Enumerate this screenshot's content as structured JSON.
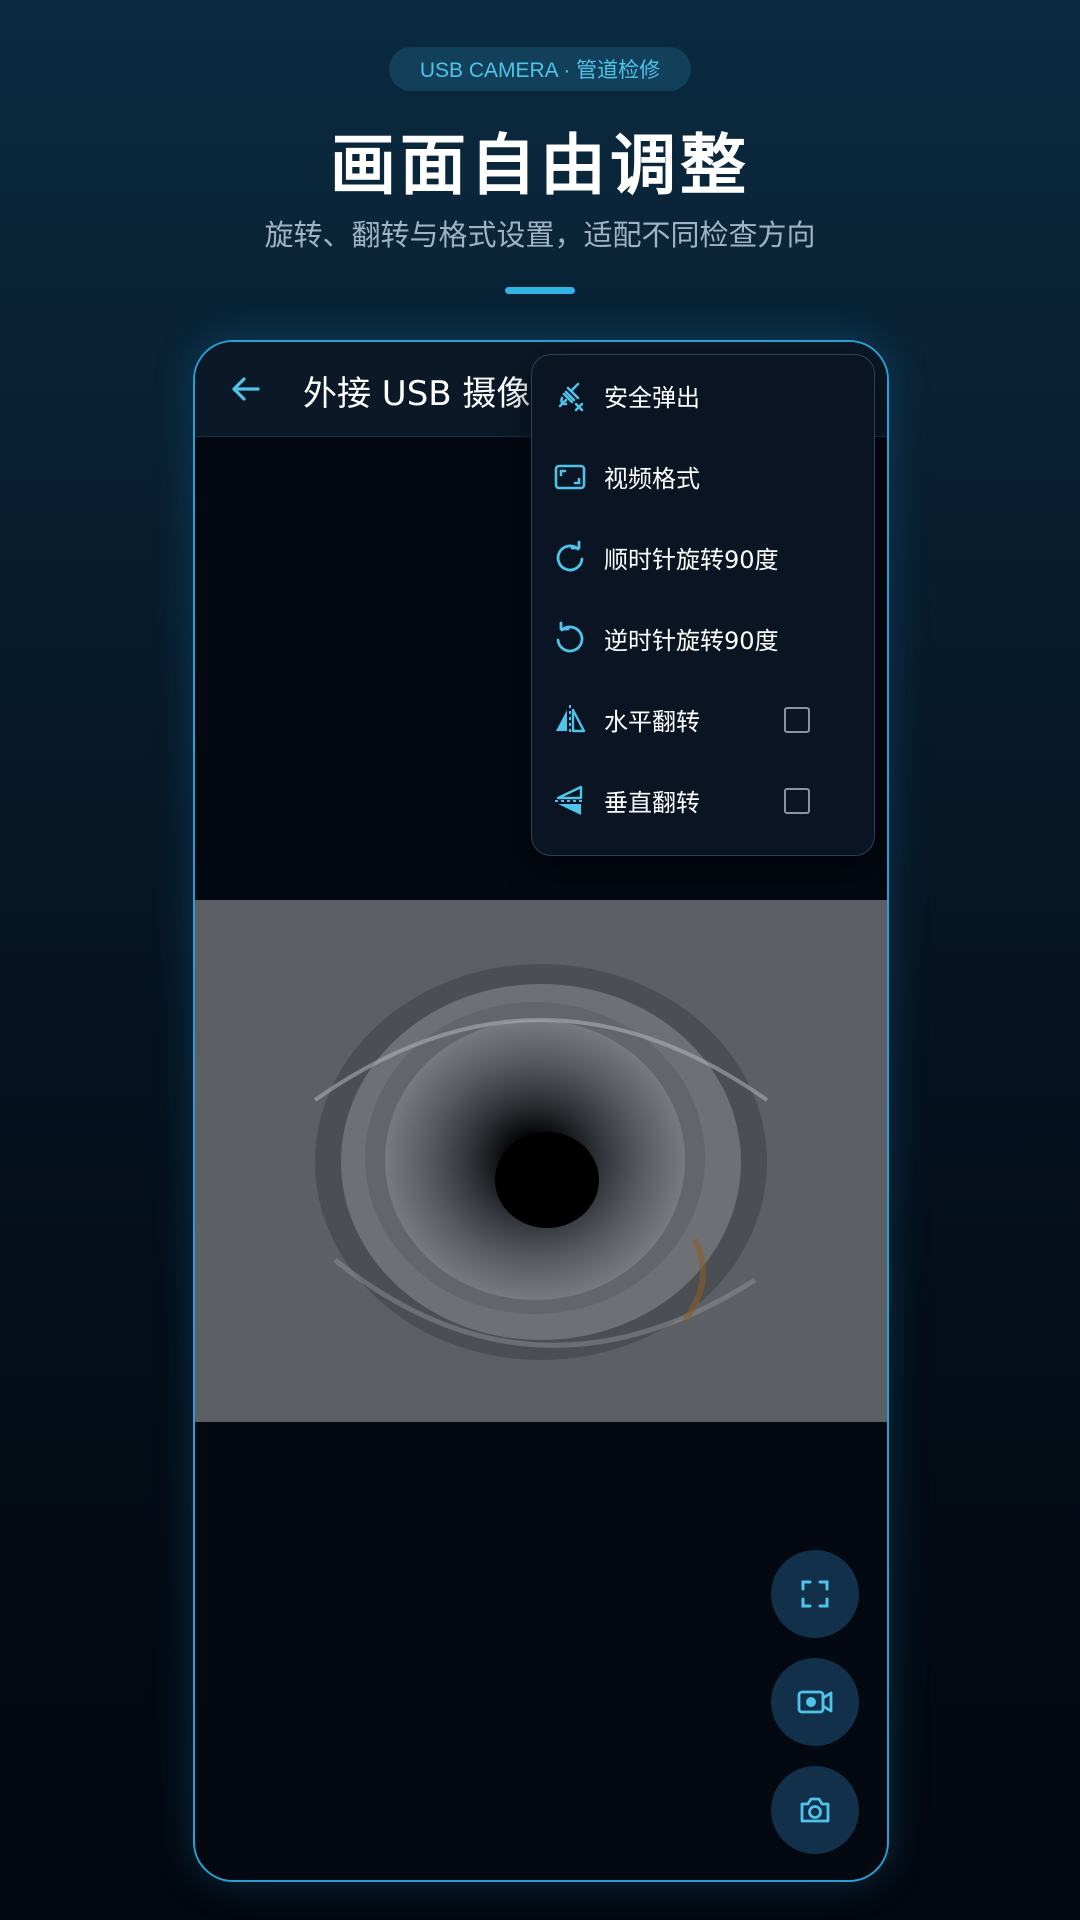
{
  "header": {
    "badge": "USB CAMERA ·  管道检修",
    "title": "画面自由调整",
    "subtitle": "旋转、翻转与格式设置，适配不同检查方向"
  },
  "app": {
    "title": "外接 USB 摄像头",
    "back_icon": "arrow-left-icon",
    "menu": {
      "items": [
        {
          "label": "安全弹出",
          "icon": "unplug-icon"
        },
        {
          "label": "视频格式",
          "icon": "aspect-ratio-icon"
        },
        {
          "label": "顺时针旋转90度",
          "icon": "rotate-cw-icon"
        },
        {
          "label": "逆时针旋转90度",
          "icon": "rotate-ccw-icon"
        },
        {
          "label": "水平翻转",
          "icon": "flip-horizontal-icon",
          "checked": false
        },
        {
          "label": "垂直翻转",
          "icon": "flip-vertical-icon",
          "checked": false
        }
      ]
    },
    "fabs": [
      {
        "icon": "fullscreen-icon"
      },
      {
        "icon": "record-video-icon"
      },
      {
        "icon": "camera-icon"
      }
    ]
  },
  "colors": {
    "accent": "#4fc3ea",
    "background_top": "#0b2a40",
    "background_bottom": "#03070f",
    "frame_border": "#2a9fd0"
  }
}
